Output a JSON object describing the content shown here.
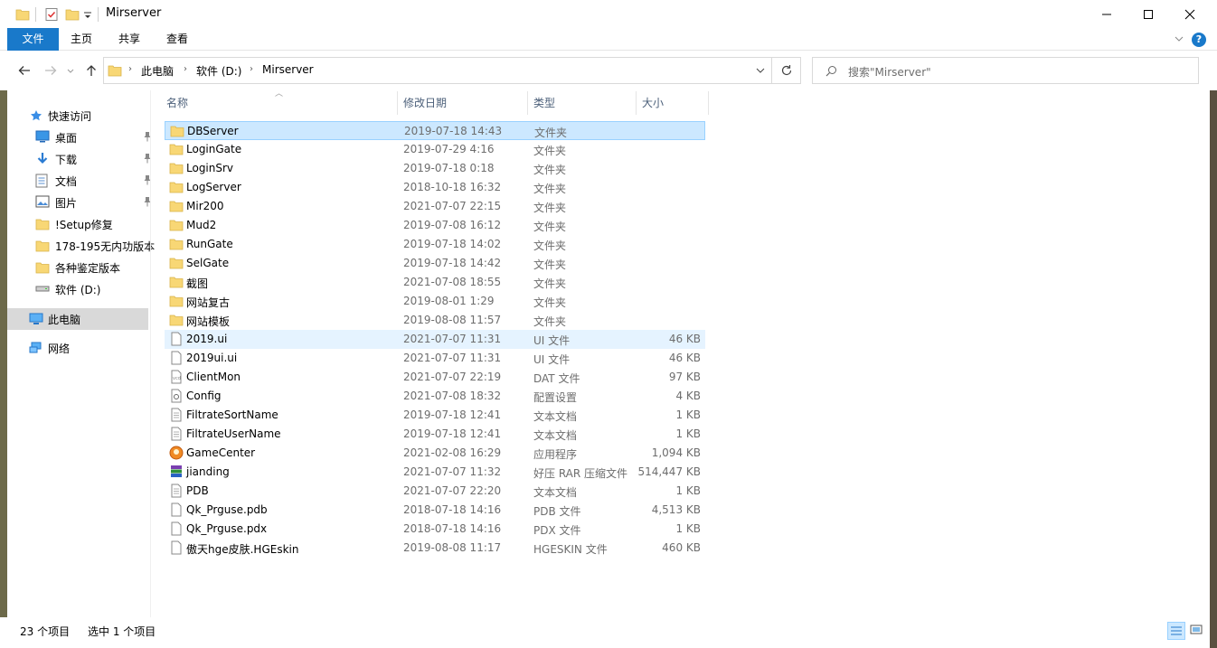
{
  "window": {
    "title": "Mirserver"
  },
  "ribbon": {
    "tabs": [
      "文件",
      "主页",
      "共享",
      "查看"
    ]
  },
  "address": {
    "crumbs": [
      "此电脑",
      "软件 (D:)",
      "Mirserver"
    ]
  },
  "search": {
    "placeholder": "搜索\"Mirserver\""
  },
  "nav": {
    "quick_access": "快速访问",
    "items": [
      {
        "label": "桌面",
        "icon": "desktop-icon",
        "pinned": true
      },
      {
        "label": "下载",
        "icon": "download-icon",
        "pinned": true
      },
      {
        "label": "文档",
        "icon": "documents-icon",
        "pinned": true
      },
      {
        "label": "图片",
        "icon": "pictures-icon",
        "pinned": true
      },
      {
        "label": "!Setup修复",
        "icon": "folder-icon",
        "pinned": false
      },
      {
        "label": "178-195无内功版本",
        "icon": "folder-icon",
        "pinned": false
      },
      {
        "label": "各种鉴定版本",
        "icon": "folder-icon",
        "pinned": false
      },
      {
        "label": "软件 (D:)",
        "icon": "drive-icon",
        "pinned": false
      }
    ],
    "this_pc": "此电脑",
    "network": "网络"
  },
  "columns": {
    "name": "名称",
    "date": "修改日期",
    "type": "类型",
    "size": "大小"
  },
  "files": [
    {
      "name": "DBServer",
      "date": "2019-07-18 14:43",
      "type": "文件夹",
      "size": "",
      "icon": "folder"
    },
    {
      "name": "LoginGate",
      "date": "2019-07-29 4:16",
      "type": "文件夹",
      "size": "",
      "icon": "folder"
    },
    {
      "name": "LoginSrv",
      "date": "2019-07-18 0:18",
      "type": "文件夹",
      "size": "",
      "icon": "folder"
    },
    {
      "name": "LogServer",
      "date": "2018-10-18 16:32",
      "type": "文件夹",
      "size": "",
      "icon": "folder"
    },
    {
      "name": "Mir200",
      "date": "2021-07-07 22:15",
      "type": "文件夹",
      "size": "",
      "icon": "folder"
    },
    {
      "name": "Mud2",
      "date": "2019-07-08 16:12",
      "type": "文件夹",
      "size": "",
      "icon": "folder"
    },
    {
      "name": "RunGate",
      "date": "2019-07-18 14:02",
      "type": "文件夹",
      "size": "",
      "icon": "folder"
    },
    {
      "name": "SelGate",
      "date": "2019-07-18 14:42",
      "type": "文件夹",
      "size": "",
      "icon": "folder"
    },
    {
      "name": "截图",
      "date": "2021-07-08 18:55",
      "type": "文件夹",
      "size": "",
      "icon": "folder"
    },
    {
      "name": "网站复古",
      "date": "2019-08-01 1:29",
      "type": "文件夹",
      "size": "",
      "icon": "folder"
    },
    {
      "name": "网站模板",
      "date": "2019-08-08 11:57",
      "type": "文件夹",
      "size": "",
      "icon": "folder"
    },
    {
      "name": "2019.ui",
      "date": "2021-07-07 11:31",
      "type": "UI 文件",
      "size": "46 KB",
      "icon": "file"
    },
    {
      "name": "2019ui.ui",
      "date": "2021-07-07 11:31",
      "type": "UI 文件",
      "size": "46 KB",
      "icon": "file"
    },
    {
      "name": "ClientMon",
      "date": "2021-07-07 22:19",
      "type": "DAT 文件",
      "size": "97 KB",
      "icon": "dat"
    },
    {
      "name": "Config",
      "date": "2021-07-08 18:32",
      "type": "配置设置",
      "size": "4 KB",
      "icon": "config"
    },
    {
      "name": "FiltrateSortName",
      "date": "2019-07-18 12:41",
      "type": "文本文档",
      "size": "1 KB",
      "icon": "text"
    },
    {
      "name": "FiltrateUserName",
      "date": "2019-07-18 12:41",
      "type": "文本文档",
      "size": "1 KB",
      "icon": "text"
    },
    {
      "name": "GameCenter",
      "date": "2021-02-08 16:29",
      "type": "应用程序",
      "size": "1,094 KB",
      "icon": "app"
    },
    {
      "name": "jianding",
      "date": "2021-07-07 11:32",
      "type": "好压 RAR 压缩文件",
      "size": "514,447 KB",
      "icon": "rar"
    },
    {
      "name": "PDB",
      "date": "2021-07-07 22:20",
      "type": "文本文档",
      "size": "1 KB",
      "icon": "text"
    },
    {
      "name": "Qk_Prguse.pdb",
      "date": "2018-07-18 14:16",
      "type": "PDB 文件",
      "size": "4,513 KB",
      "icon": "file"
    },
    {
      "name": "Qk_Prguse.pdx",
      "date": "2018-07-18 14:16",
      "type": "PDX 文件",
      "size": "1 KB",
      "icon": "file"
    },
    {
      "name": "傲天hge皮肤.HGEskin",
      "date": "2019-08-08 11:17",
      "type": "HGESKIN 文件",
      "size": "460 KB",
      "icon": "file"
    }
  ],
  "status": {
    "count": "23 个项目",
    "selected": "选中 1 个项目"
  },
  "colors": {
    "accent": "#1979ca",
    "selection": "#cce8ff",
    "folder": "#f8d775"
  }
}
